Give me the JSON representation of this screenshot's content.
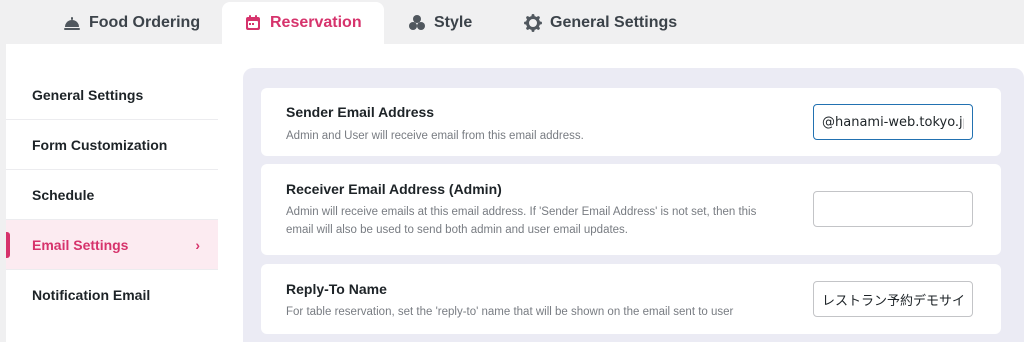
{
  "tabs": [
    {
      "label": "Food Ordering",
      "icon": "cloche-icon"
    },
    {
      "label": "Reservation",
      "icon": "calendar-icon"
    },
    {
      "label": "Style",
      "icon": "palette-icon"
    },
    {
      "label": "General Settings",
      "icon": "gear-icon"
    }
  ],
  "sidebar": {
    "items": [
      {
        "label": "General Settings"
      },
      {
        "label": "Form Customization"
      },
      {
        "label": "Schedule"
      },
      {
        "label": "Email Settings",
        "chevron": "›"
      },
      {
        "label": "Notification Email"
      }
    ]
  },
  "settings": {
    "sender": {
      "title": "Sender Email Address",
      "description": "Admin and User will receive email from this email address.",
      "value": "@hanami-web.tokyo.jp"
    },
    "receiver": {
      "title": "Receiver Email Address (Admin)",
      "description": "Admin will receive emails at this email address. If 'Sender Email Address' is not set, then this email will also be used to send both admin and user email updates.",
      "value": ""
    },
    "reply_to": {
      "title": "Reply-To Name",
      "description": "For table reservation, set the 'reply-to' name that will be shown on the email sent to user",
      "value": "レストラン予約デモサイ"
    }
  },
  "colors": {
    "accent": "#d6336c",
    "focus": "#2271b1"
  }
}
